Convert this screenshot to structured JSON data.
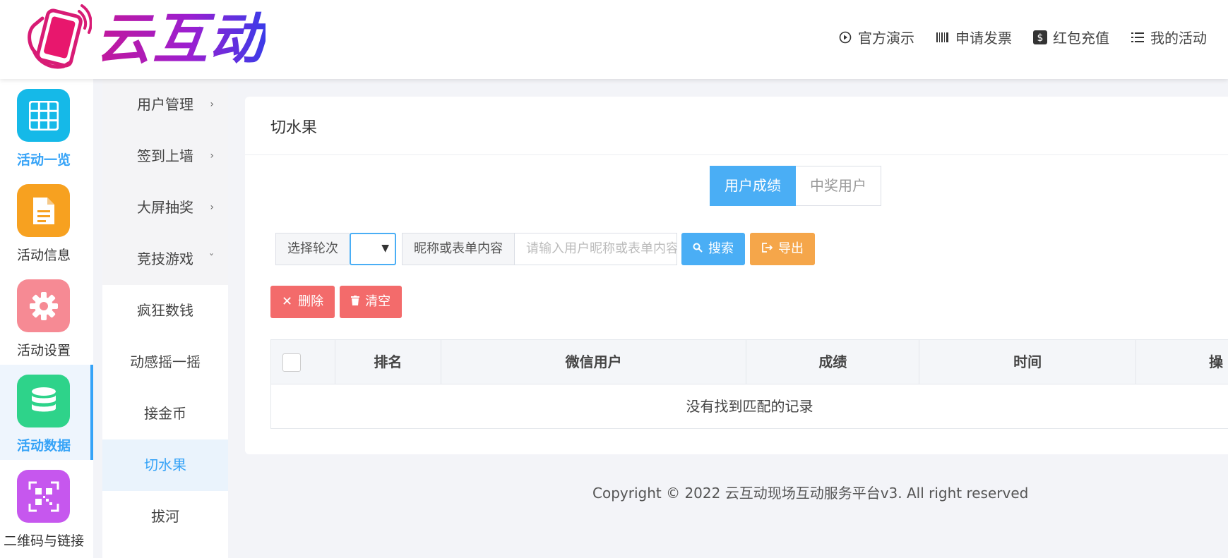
{
  "brand": {
    "name": "云互动"
  },
  "top_nav": [
    {
      "label": "官方演示",
      "icon": "play-circle-icon"
    },
    {
      "label": "申请发票",
      "icon": "barcode-icon"
    },
    {
      "label": "红包充值",
      "icon": "dollar-icon"
    },
    {
      "label": "我的活动",
      "icon": "list-icon"
    }
  ],
  "icon_nav": [
    {
      "label": "活动一览",
      "icon": "grid-icon",
      "color": "#15b9e8"
    },
    {
      "label": "活动信息",
      "icon": "document-icon",
      "color": "#f7a120"
    },
    {
      "label": "活动设置",
      "icon": "gear-icon",
      "color": "#f68a94"
    },
    {
      "label": "活动数据",
      "icon": "database-icon",
      "color": "#2ed38a"
    },
    {
      "label": "二维码与链接",
      "icon": "qrcode-icon",
      "color": "#c657ee"
    }
  ],
  "sub_nav": [
    {
      "label": "用户管理",
      "arrow": "›"
    },
    {
      "label": "签到上墙",
      "arrow": "›"
    },
    {
      "label": "大屏抽奖",
      "arrow": "›"
    },
    {
      "label": "竞技游戏",
      "arrow": "ˇ"
    },
    {
      "label": "疯狂数钱"
    },
    {
      "label": "动感摇一摇"
    },
    {
      "label": "接金币"
    },
    {
      "label": "切水果"
    },
    {
      "label": "拔河"
    }
  ],
  "panel": {
    "title": "切水果",
    "tabs": [
      "用户成绩",
      "中奖用户"
    ],
    "filter": {
      "round_label": "选择轮次",
      "round_value": "",
      "keyword_label": "昵称或表单内容",
      "keyword_placeholder": "请输入用户昵称或表单内容",
      "search_label": "搜索",
      "export_label": "导出"
    },
    "actions": {
      "delete_label": "删除",
      "clear_label": "清空"
    },
    "table": {
      "columns": [
        "排名",
        "微信用户",
        "成绩",
        "时间",
        "操"
      ],
      "empty_text": "没有找到匹配的记录"
    }
  },
  "footer": {
    "text": "Copyright © 2022 云互动现场互动服务平台v3. All right reserved"
  },
  "colors": {
    "accent": "#4aaef5",
    "export": "#f5a64a",
    "danger": "#f36b6b"
  }
}
